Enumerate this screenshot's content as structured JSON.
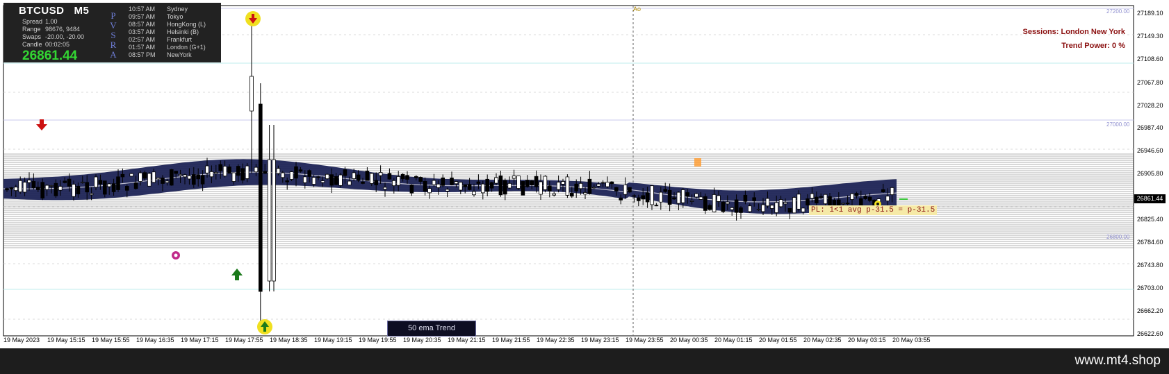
{
  "symbol": {
    "name": "BTCUSD",
    "timeframe": "M5"
  },
  "stats": [
    {
      "label": "Spread",
      "value": "1.00"
    },
    {
      "label": "Range",
      "value": "98676, 9484"
    },
    {
      "label": "Swaps",
      "value": "-20.00, -20.00"
    },
    {
      "label": "Candle",
      "value": "00:02:05"
    }
  ],
  "big_price": "26861.44",
  "pvsra": [
    "P",
    "V",
    "S",
    "R",
    "A"
  ],
  "sessions_list": [
    {
      "time": "10:57 AM",
      "city": "Sydney"
    },
    {
      "time": "09:57 AM",
      "city": "Tokyo"
    },
    {
      "time": "08:57 AM",
      "city": "HongKong  (L)"
    },
    {
      "time": "03:57 AM",
      "city": "Helsinki  (B)"
    },
    {
      "time": "02:57 AM",
      "city": "Frankfurt"
    },
    {
      "time": "01:57 AM",
      "city": "London  (G+1)"
    },
    {
      "time": "08:57 PM",
      "city": "NewYork"
    }
  ],
  "sessions_text": "Sessions:  London  New York",
  "trend_power": "Trend Power: 0 %",
  "price_axis": [
    "27189.10",
    "27149.30",
    "27108.60",
    "27067.80",
    "27028.20",
    "26987.40",
    "26946.60",
    "26905.80",
    "26825.40",
    "26784.60",
    "26743.80",
    "26703.00",
    "26662.20",
    "26622.60"
  ],
  "current_price": "26861.44",
  "level_tags": {
    "top": "27200.00",
    "mid": "27000.00",
    "low": "26800.00"
  },
  "time_axis": [
    "19 May 2023",
    "19 May 15:15",
    "19 May 15:55",
    "19 May 16:35",
    "19 May 17:15",
    "19 May 17:55",
    "19 May 18:35",
    "19 May 19:15",
    "19 May 19:55",
    "19 May 20:35",
    "19 May 21:15",
    "19 May 21:55",
    "19 May 22:35",
    "19 May 23:15",
    "19 May 23:55",
    "20 May 00:35",
    "20 May 01:15",
    "20 May 01:55",
    "20 May 02:35",
    "20 May 03:15",
    "20 May 03:55"
  ],
  "ema_label": "50 ema Trend",
  "pl_label": "PL: 1<1 avg p-31.5 = p-31.5",
  "ao_label": "Ao",
  "footer_brand": "www.mt4.shop",
  "colors": {
    "band": "#1e2456",
    "bull": "#ffffff",
    "bear": "#000000",
    "signal_up": "#1b7a1b",
    "signal_down": "#cc1111",
    "price_text": "#33d633"
  }
}
